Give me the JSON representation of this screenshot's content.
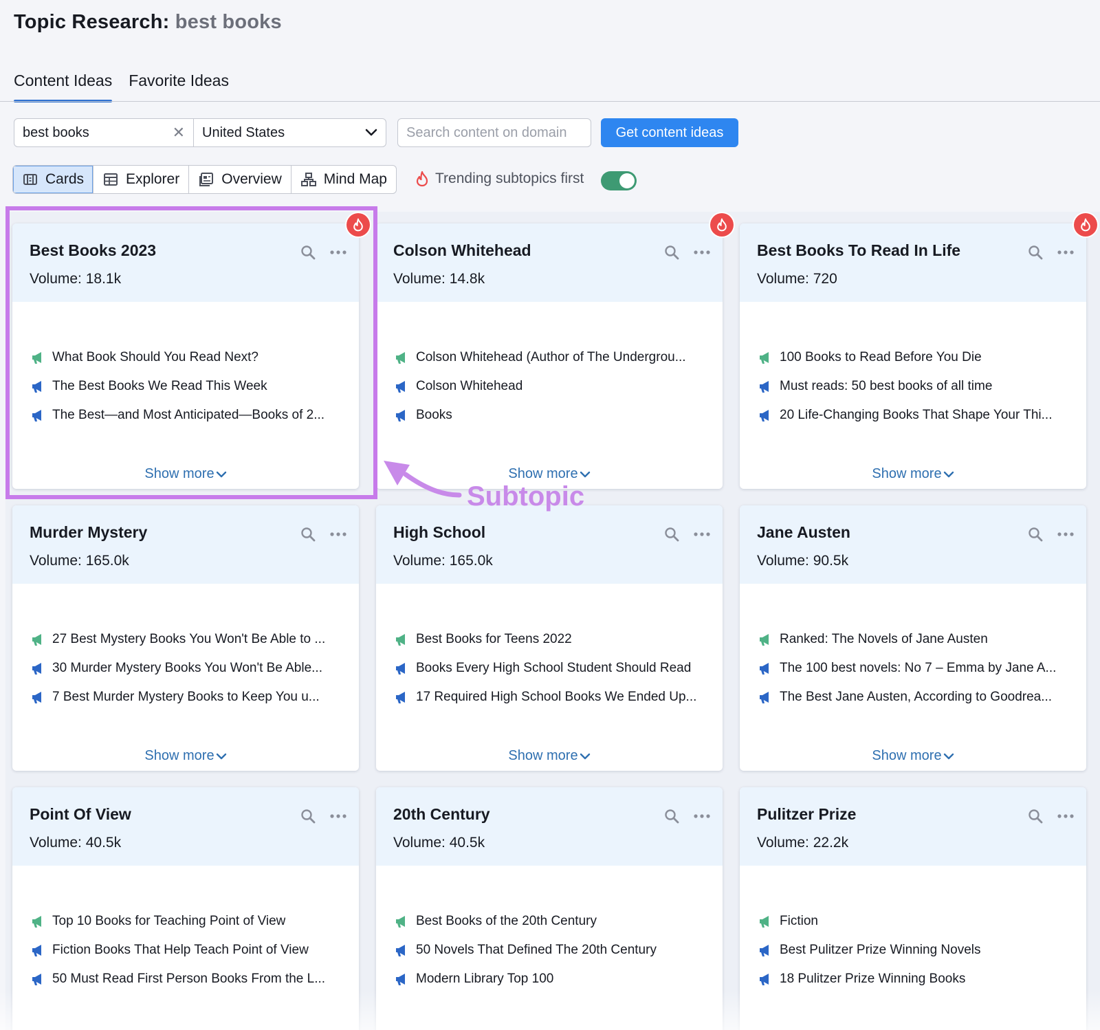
{
  "header": {
    "title_prefix": "Topic Research:",
    "title_keyword": "best books"
  },
  "tabs": [
    {
      "label": "Content Ideas",
      "active": true
    },
    {
      "label": "Favorite Ideas",
      "active": false
    }
  ],
  "search": {
    "keyword": "best books",
    "country": "United States",
    "domain_placeholder": "Search content on domain",
    "submit_label": "Get content ideas"
  },
  "views": [
    {
      "label": "Cards",
      "icon": "cards-icon",
      "active": true
    },
    {
      "label": "Explorer",
      "icon": "table-icon",
      "active": false
    },
    {
      "label": "Overview",
      "icon": "overview-icon",
      "active": false
    },
    {
      "label": "Mind Map",
      "icon": "mindmap-icon",
      "active": false
    }
  ],
  "trending": {
    "label": "Trending subtopics first",
    "enabled": true,
    "icon": "fire-icon"
  },
  "colors": {
    "accent": "#2e86f0",
    "toggle_on": "#3e9a73",
    "trending_badge": "#ec4b4b",
    "highlight": "#c77bea",
    "headline_green": "#4fb286",
    "headline_blue": "#2b66c6"
  },
  "volume_label": "Volume:",
  "show_more_label": "Show more",
  "annotation": {
    "label": "Subtopic"
  },
  "cards": [
    {
      "title": "Best Books 2023",
      "volume": "18.1k",
      "trending": true,
      "headlines": [
        {
          "text": "What Book Should You Read Next?",
          "icon": "megaphone-green-icon"
        },
        {
          "text": "The Best Books We Read This Week",
          "icon": "megaphone-blue-icon"
        },
        {
          "text": "The Best—and Most Anticipated—Books of 2...",
          "icon": "megaphone-blue-icon"
        }
      ]
    },
    {
      "title": "Colson Whitehead",
      "volume": "14.8k",
      "trending": true,
      "headlines": [
        {
          "text": "Colson Whitehead (Author of The Undergrou...",
          "icon": "megaphone-green-icon"
        },
        {
          "text": "Colson Whitehead",
          "icon": "megaphone-blue-icon"
        },
        {
          "text": "Books",
          "icon": "megaphone-blue-icon"
        }
      ]
    },
    {
      "title": "Best Books To Read In Life",
      "volume": "720",
      "trending": true,
      "headlines": [
        {
          "text": "100 Books to Read Before You Die",
          "icon": "megaphone-green-icon"
        },
        {
          "text": "Must reads: 50 best books of all time",
          "icon": "megaphone-blue-icon"
        },
        {
          "text": "20 Life-Changing Books That Shape Your Thi...",
          "icon": "megaphone-blue-icon"
        }
      ]
    },
    {
      "title": "Murder Mystery",
      "volume": "165.0k",
      "trending": false,
      "headlines": [
        {
          "text": "27 Best Mystery Books You Won't Be Able to ...",
          "icon": "megaphone-green-icon"
        },
        {
          "text": "30 Murder Mystery Books You Won't Be Able...",
          "icon": "megaphone-blue-icon"
        },
        {
          "text": "7 Best Murder Mystery Books to Keep You u...",
          "icon": "megaphone-blue-icon"
        }
      ]
    },
    {
      "title": "High School",
      "volume": "165.0k",
      "trending": false,
      "headlines": [
        {
          "text": "Best Books for Teens 2022",
          "icon": "megaphone-green-icon"
        },
        {
          "text": "Books Every High School Student Should Read",
          "icon": "megaphone-blue-icon"
        },
        {
          "text": "17 Required High School Books We Ended Up...",
          "icon": "megaphone-blue-icon"
        }
      ]
    },
    {
      "title": "Jane Austen",
      "volume": "90.5k",
      "trending": false,
      "headlines": [
        {
          "text": "Ranked: The Novels of Jane Austen",
          "icon": "megaphone-green-icon"
        },
        {
          "text": "The 100 best novels: No 7 – Emma by Jane A...",
          "icon": "megaphone-blue-icon"
        },
        {
          "text": "The Best Jane Austen, According to Goodrea...",
          "icon": "megaphone-blue-icon"
        }
      ]
    },
    {
      "title": "Point Of View",
      "volume": "40.5k",
      "trending": false,
      "headlines": [
        {
          "text": "Top 10 Books for Teaching Point of View",
          "icon": "megaphone-green-icon"
        },
        {
          "text": "Fiction Books That Help Teach Point of View",
          "icon": "megaphone-blue-icon"
        },
        {
          "text": "50 Must Read First Person Books From the L...",
          "icon": "megaphone-blue-icon"
        }
      ]
    },
    {
      "title": "20th Century",
      "volume": "40.5k",
      "trending": false,
      "headlines": [
        {
          "text": "Best Books of the 20th Century",
          "icon": "megaphone-green-icon"
        },
        {
          "text": "50 Novels That Defined The 20th Century",
          "icon": "megaphone-blue-icon"
        },
        {
          "text": "Modern Library Top 100",
          "icon": "megaphone-blue-icon"
        }
      ]
    },
    {
      "title": "Pulitzer Prize",
      "volume": "22.2k",
      "trending": false,
      "headlines": [
        {
          "text": "Fiction",
          "icon": "megaphone-green-icon"
        },
        {
          "text": "Best Pulitzer Prize Winning Novels",
          "icon": "megaphone-blue-icon"
        },
        {
          "text": "18 Pulitzer Prize Winning Books",
          "icon": "megaphone-blue-icon"
        }
      ]
    }
  ]
}
